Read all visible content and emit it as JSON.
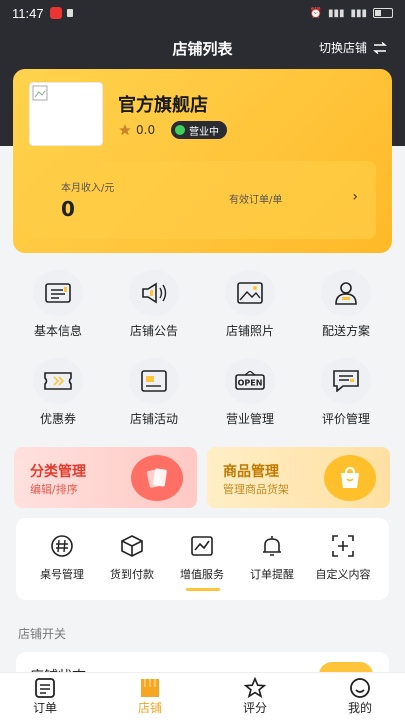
{
  "status_bar": {
    "time": "11:47"
  },
  "nav": {
    "title": "店铺列表",
    "switch_label": "切换店铺"
  },
  "store": {
    "name": "官方旗舰店",
    "rating": "0.0",
    "status": "营业中",
    "monthly_income_label": "本月收入/元",
    "monthly_income_value": "0",
    "valid_orders_label": "有效订单/单"
  },
  "grid": [
    {
      "label": "基本信息",
      "icon": "id-card-icon"
    },
    {
      "label": "店铺公告",
      "icon": "megaphone-icon"
    },
    {
      "label": "店铺照片",
      "icon": "image-icon"
    },
    {
      "label": "配送方案",
      "icon": "courier-icon"
    },
    {
      "label": "优惠券",
      "icon": "coupon-icon"
    },
    {
      "label": "店铺活动",
      "icon": "activity-icon"
    },
    {
      "label": "营业管理",
      "icon": "open-sign-icon"
    },
    {
      "label": "评价管理",
      "icon": "review-icon"
    }
  ],
  "promos": [
    {
      "title": "分类管理",
      "subtitle": "编辑/排序",
      "accent": "#e23b2e"
    },
    {
      "title": "商品管理",
      "subtitle": "管理商品货架",
      "accent": "#c07a00"
    }
  ],
  "tools": [
    {
      "label": "桌号管理",
      "icon": "hash-icon"
    },
    {
      "label": "货到付款",
      "icon": "box-icon"
    },
    {
      "label": "增值服务",
      "icon": "chart-icon"
    },
    {
      "label": "订单提醒",
      "icon": "bell-icon"
    },
    {
      "label": "自定义内容",
      "icon": "add-frame-icon"
    }
  ],
  "section": {
    "title": "店铺开关",
    "first_item": "店铺状态"
  },
  "tabs": [
    {
      "label": "订单",
      "icon": "order-icon"
    },
    {
      "label": "店铺",
      "icon": "store-icon",
      "active": true
    },
    {
      "label": "评分",
      "icon": "star-icon"
    },
    {
      "label": "我的",
      "icon": "profile-icon"
    }
  ],
  "colors": {
    "accent": "#ffc43a",
    "dark": "#2b2c31",
    "active_tab": "#f5a623"
  }
}
